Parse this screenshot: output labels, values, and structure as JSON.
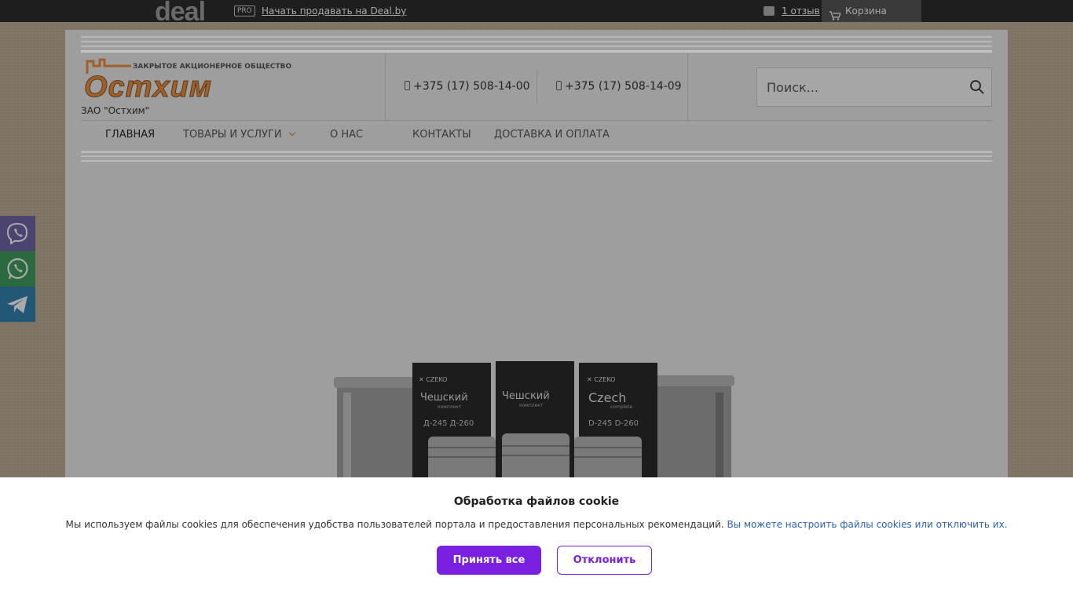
{
  "topbar": {
    "logo": "deal",
    "pro_badge": "PRO",
    "sell_link": "Начать продавать на Deal.by",
    "reviews_link": "1 отзыв",
    "cart_label": "Корзина"
  },
  "header": {
    "logo_subtitle": "ЗАКРЫТОЕ АКЦИОНЕРНОЕ ОБЩЕСТВО",
    "logo_main": "Остхим",
    "company_name": "ЗАО \"Остхим\"",
    "phones": [
      "+375 (17) 508-14-00",
      "+375 (17) 508-14-09"
    ],
    "search_placeholder": "Поиск..."
  },
  "nav": {
    "items": [
      {
        "label": "ГЛАВНАЯ"
      },
      {
        "label": "ТОВАРЫ И УСЛУГИ"
      },
      {
        "label": "О НАС"
      },
      {
        "label": "КОНТАКТЫ"
      },
      {
        "label": "ДОСТАВКА И ОПЛАТА"
      }
    ]
  },
  "product": {
    "box_labels": [
      {
        "brand": "CZEKO",
        "name": "Чешский",
        "sub": "комплект",
        "models": "Д-245 Д-260"
      },
      {
        "brand": "",
        "name": "Чешский",
        "sub": "комплект",
        "models": ""
      },
      {
        "brand": "CZEKO",
        "name": "Czech",
        "sub": "complete",
        "models": "D-245 D-260"
      }
    ]
  },
  "social": {
    "icons": [
      "viber-icon",
      "whatsapp-icon",
      "telegram-icon"
    ]
  },
  "cookie": {
    "title": "Обработка файлов cookie",
    "text": "Мы используем файлы cookies для обеспечения удобства пользователей портала и предоставления персональных рекомендаций.",
    "link": "Вы можете настроить файлы cookies или отключить их.",
    "accept": "Принять все",
    "decline": "Отклонить"
  },
  "colors": {
    "accent": "#7b1fe0",
    "link": "#2a63b8",
    "topbar": "#1e1e1e"
  }
}
